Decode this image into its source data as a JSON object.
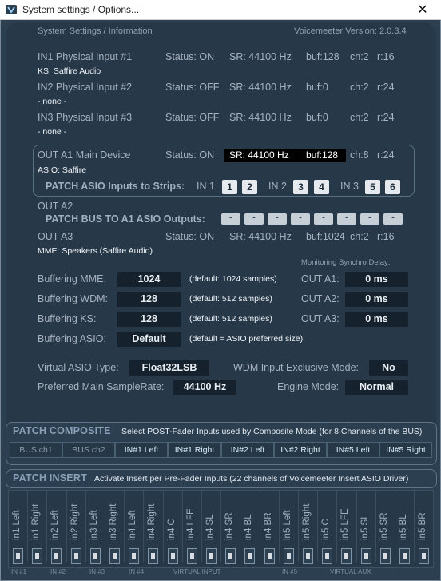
{
  "window": {
    "title": "System settings / Options...",
    "close_glyph": "✕"
  },
  "header": {
    "left": "System Settings / Information",
    "right": "Voicemeeter Version: 2.0.3.4"
  },
  "inputs": [
    {
      "name": "IN1 Physical Input #1",
      "status": "Status: ON",
      "sr": "SR: 44100 Hz",
      "buf": "buf:128",
      "ch": "ch:2",
      "r": "r:16",
      "device": "KS: Saffire Audio"
    },
    {
      "name": "IN2 Physical Input #2",
      "status": "Status: OFF",
      "sr": "SR: 44100 Hz",
      "buf": "buf:0",
      "ch": "ch:2",
      "r": "r:24",
      "device": "- none -"
    },
    {
      "name": "IN3 Physical Input #3",
      "status": "Status: OFF",
      "sr": "SR: 44100 Hz",
      "buf": "buf:0",
      "ch": "ch:2",
      "r": "r:24",
      "device": "- none -"
    }
  ],
  "out_a1": {
    "name": "OUT A1 Main Device",
    "status": "Status: ON",
    "sr": "SR: 44100 Hz",
    "buf": "buf:128",
    "ch": "ch:8",
    "r": "r:24",
    "device": "ASIO: Saffire",
    "patch_label": "PATCH ASIO Inputs to Strips:",
    "in1": "IN 1",
    "in2": "IN 2",
    "in3": "IN 3",
    "b1": "1",
    "b2": "2",
    "b3": "3",
    "b4": "4",
    "b5": "5",
    "b6": "6"
  },
  "out_a2": {
    "name": "OUT A2",
    "patch_label": "PATCH BUS TO A1 ASIO Outputs:",
    "dash": "-"
  },
  "out_a3": {
    "name": "OUT A3",
    "status": "Status: ON",
    "sr": "SR: 44100 Hz",
    "buf": "buf:1024",
    "ch": "ch:2",
    "r": "r:16",
    "device": "MME: Speakers (Saffire Audio)"
  },
  "buffering": {
    "mme": {
      "label": "Buffering MME:",
      "value": "1024",
      "note": "(default: 1024 samples)"
    },
    "wdm": {
      "label": "Buffering WDM:",
      "value": "128",
      "note": "(default: 512 samples)"
    },
    "ks": {
      "label": "Buffering KS:",
      "value": "128",
      "note": "(default: 512 samples)"
    },
    "asio": {
      "label": "Buffering ASIO:",
      "value": "Default",
      "note": "(default = ASIO preferred size)"
    }
  },
  "sync_delay": {
    "title": "Monitoring Synchro Delay:",
    "a1_label": "OUT A1:",
    "a1": "0 ms",
    "a2_label": "OUT A2:",
    "a2": "0 ms",
    "a3_label": "OUT A3:",
    "a3": "0 ms"
  },
  "virtual_asio": {
    "label": "Virtual ASIO Type:",
    "value": "Float32LSB"
  },
  "wdm_exclusive": {
    "label": "WDM Input Exclusive Mode:",
    "value": "No"
  },
  "samplerate": {
    "label": "Preferred Main SampleRate:",
    "value": "44100 Hz"
  },
  "engine": {
    "label": "Engine Mode:",
    "value": "Normal"
  },
  "composite": {
    "title": "PATCH COMPOSITE",
    "desc": "Select POST-Fader Inputs used by Composite Mode (for 8 Channels of the BUS)",
    "buttons": [
      "BUS ch1",
      "BUS ch2",
      "IN#1 Left",
      "IN#1 Right",
      "IN#2 Left",
      "IN#2 Right",
      "IN#5 Left",
      "IN#5 Right"
    ]
  },
  "insert": {
    "title": "PATCH INSERT",
    "desc": "Activate Insert per Pre-Fader Inputs (22 channels of Voicemeeter Insert ASIO Driver)",
    "channels": [
      "in1 Left",
      "in1 Right",
      "in2 Left",
      "in2 Right",
      "in3 Left",
      "in3 Right",
      "in4 Left",
      "in4 Right",
      "in4 C",
      "in4 LFE",
      "in4 SL",
      "in4 SR",
      "in4 BL",
      "in4 BR",
      "in5 Left",
      "in5 Right",
      "in5 C",
      "in5 LFE",
      "in5 SL",
      "in5 SR",
      "in5 BL",
      "in5 BR"
    ],
    "groups": {
      "in1": "IN #1",
      "in2": "IN #2",
      "in3": "IN #3",
      "in4": "IN #4",
      "virtual_input": "VIRTUAL INPUT",
      "in5": "IN #5",
      "virtual_aux": "VIRTUAL AUX"
    }
  },
  "colors": {
    "background": "#2c3f51",
    "panel": "#273849",
    "button": "#15222e",
    "highlight": "#000000"
  }
}
